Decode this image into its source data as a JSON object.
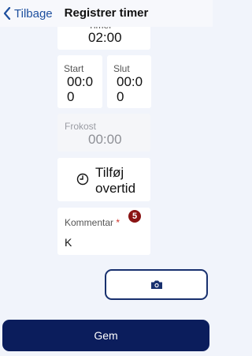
{
  "nav": {
    "back_label": "Tilbage",
    "title": "Registrer timer"
  },
  "hours": {
    "label": "Timer",
    "value": "02:00"
  },
  "start": {
    "label": "Start",
    "value_line1": "00:0",
    "value_line2": "0"
  },
  "end": {
    "label": "Slut",
    "value_line1": "00:0",
    "value_line2": "0"
  },
  "lunch": {
    "label": "Frokost",
    "value": "00:00"
  },
  "overtime": {
    "label_line1": "Tilføj",
    "label_line2": "overtid",
    "icon": "clock-icon"
  },
  "comment": {
    "label": "Kommentar",
    "required_mark": "*",
    "value": "K",
    "badge": "5"
  },
  "camera": {
    "icon": "camera-icon"
  },
  "save": {
    "label": "Gem"
  },
  "colors": {
    "accent": "#1d4f9e",
    "primary_button": "#0b1d5c",
    "badge": "#8a1414",
    "background": "#f1f4fb"
  }
}
